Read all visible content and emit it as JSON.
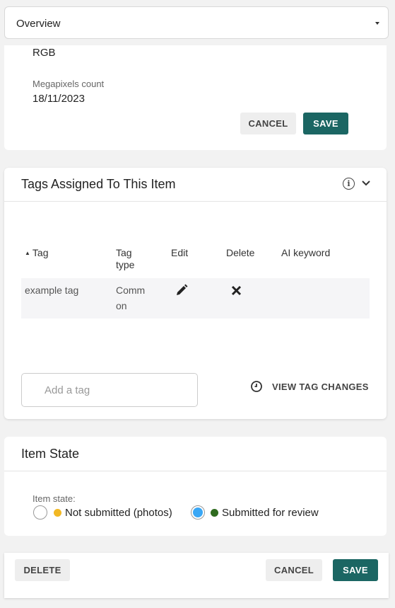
{
  "section_select": {
    "value": "Overview"
  },
  "details": {
    "color_mode_value": "RGB",
    "megapixels_label": "Megapixels count",
    "megapixels_value": "18/11/2023",
    "cancel_label": "CANCEL",
    "save_label": "SAVE"
  },
  "tags_panel": {
    "title": "Tags Assigned To This Item",
    "columns": [
      "Tag",
      "Tag type",
      "Edit",
      "Delete",
      "AI keyword"
    ],
    "rows": [
      {
        "tag": "example tag",
        "tag_type": "Common",
        "ai_keyword": ""
      }
    ],
    "sort_indicator": "▲",
    "add_tag_placeholder": "Add a tag",
    "view_changes_label": "VIEW TAG CHANGES"
  },
  "item_state": {
    "title": "Item State",
    "field_label": "Item state:",
    "options": [
      {
        "label": "Not submitted (photos)",
        "dot_color": "#f2b824",
        "selected": false
      },
      {
        "label": "Submitted for review",
        "dot_color": "#2f6b1f",
        "selected": true
      }
    ]
  },
  "footer": {
    "delete_label": "DELETE",
    "cancel_label": "CANCEL",
    "save_label": "SAVE"
  },
  "colors": {
    "accent": "#1b6663",
    "radio_selected": "#3aa7f5"
  },
  "icons": [
    "chevron-down-icon",
    "info-icon",
    "pencil-icon",
    "delete-x-icon",
    "history-clock-icon",
    "sort-up-icon"
  ]
}
